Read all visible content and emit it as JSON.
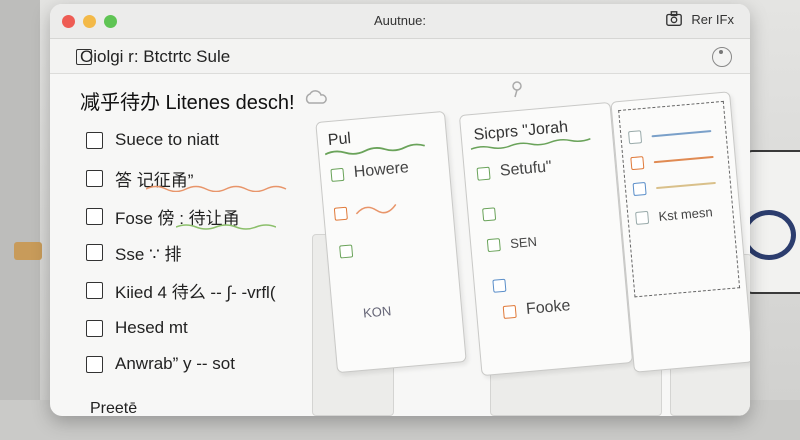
{
  "window": {
    "title": "Auutnue:",
    "right_label": "Rer IFx"
  },
  "toolbar": {
    "text": "Oiolgi r: Btctrtc Sule"
  },
  "heading": "减乎待办 Litenes desch!",
  "todos": [
    {
      "label": "Suece to niatt"
    },
    {
      "label": "答 记征甬”"
    },
    {
      "label": "Fose 傍 : 待让甬"
    },
    {
      "label": "Sse ∵ 排"
    },
    {
      "label": "Kiied 4 待么 -- ∫- -vrfl("
    },
    {
      "label": "Hesed mt"
    },
    {
      "label": "Anwrab”   y -- sot"
    }
  ],
  "footer": "Preetē",
  "cards": {
    "card1": {
      "title": "Pul",
      "items": [
        {
          "label": "Howere",
          "color": "green"
        },
        {
          "label": "",
          "color": "orange"
        },
        {
          "label": "",
          "color": "green"
        },
        {
          "label": "KON",
          "color": "none"
        }
      ]
    },
    "card2": {
      "title": "Sicprs \"Jorah",
      "items": [
        {
          "label": "Setufu\"",
          "color": "green"
        },
        {
          "label": "",
          "color": "green"
        },
        {
          "label": "SEN",
          "color": "green"
        },
        {
          "label": "",
          "color": "blue"
        },
        {
          "label": "Fooke",
          "color": "orange"
        }
      ]
    },
    "card3": {
      "items": [
        {
          "label": "",
          "color": "gray"
        },
        {
          "label": "",
          "color": "orange"
        },
        {
          "label": "",
          "color": "blue"
        },
        {
          "label": "Kst mesn",
          "color": "gray"
        }
      ]
    }
  },
  "colors": {
    "green": "#6aa35a",
    "orange": "#e07a3a",
    "blue": "#5a8ec9",
    "close": "#ee5c54",
    "minimize": "#f3b948",
    "maximize": "#5fc454"
  }
}
